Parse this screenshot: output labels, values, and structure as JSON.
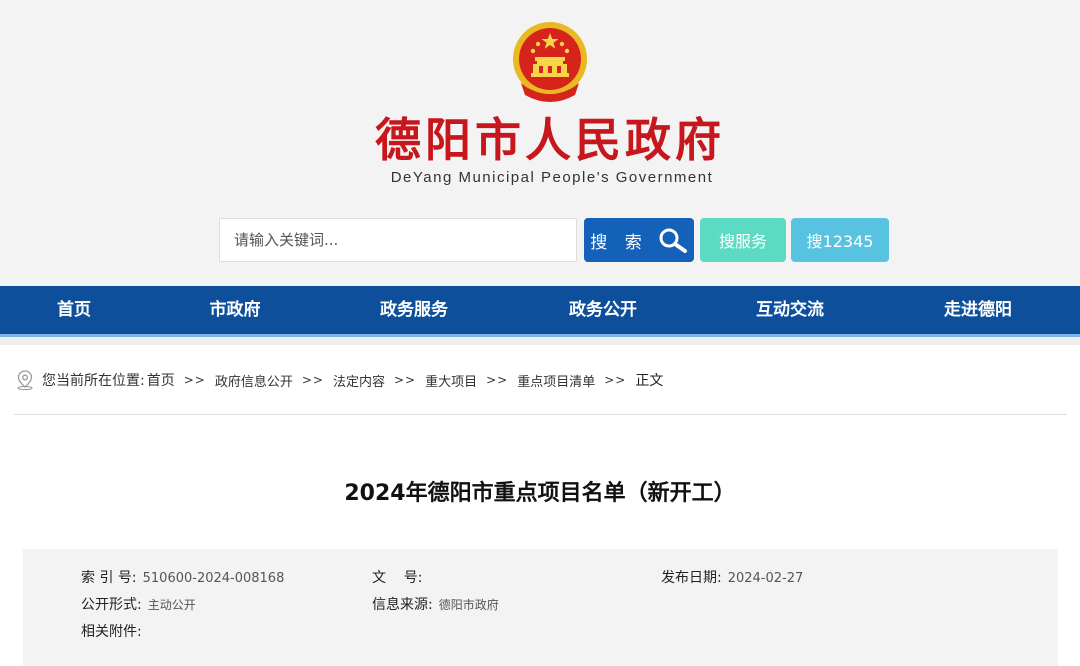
{
  "header": {
    "title": "德阳市人民政府",
    "subtitle": "DeYang Municipal People's Government",
    "colors": {
      "title": "#c8161d",
      "header_bg": "#f3f3f3"
    }
  },
  "search": {
    "placeholder": "请输入关键词...",
    "search_button": "搜 索",
    "search_icon": "search-icon",
    "service_button": "搜服务",
    "hotline_button": "搜12345",
    "colors": {
      "search": "#1361b8",
      "service": "#5ddac4",
      "hotline": "#57c3e1"
    }
  },
  "nav": {
    "color": "#0e4f9b",
    "items": [
      {
        "label": "首页"
      },
      {
        "label": "市政府"
      },
      {
        "label": "政务服务"
      },
      {
        "label": "政务公开"
      },
      {
        "label": "互动交流"
      },
      {
        "label": "走进德阳"
      }
    ]
  },
  "breadcrumb": {
    "icon": "location-pin-icon",
    "label": "您当前所在位置:",
    "separator": ">>",
    "items": [
      "首页",
      "政府信息公开",
      "法定内容",
      "重大项目",
      "重点项目清单"
    ],
    "current": "正文"
  },
  "article": {
    "title": "2024年德阳市重点项目名单（新开工）"
  },
  "meta": {
    "index_label": "索 引 号:",
    "index_value": "510600-2024-008168",
    "doc_no_label": "文    号:",
    "doc_no_value": "",
    "date_label": "发布日期:",
    "date_value": "2024-02-27",
    "form_label": "公开形式:",
    "form_value": "主动公开",
    "source_label": "信息来源:",
    "source_value": "德阳市政府",
    "attachment_label": "相关附件:"
  }
}
